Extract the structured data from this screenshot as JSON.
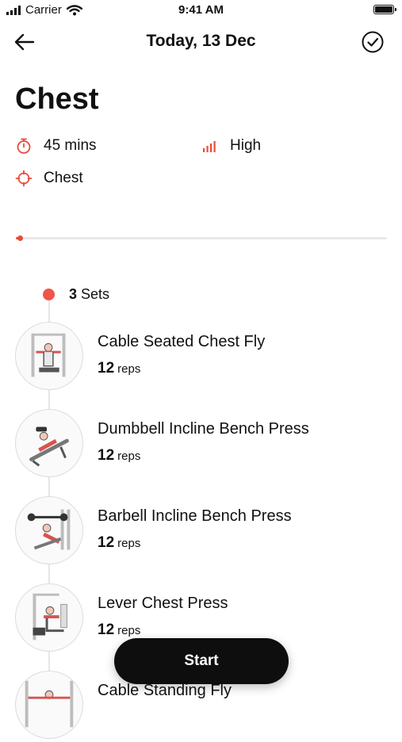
{
  "status_bar": {
    "carrier": "Carrier",
    "time": "9:41 AM"
  },
  "nav": {
    "title": "Today, 13 Dec",
    "back_icon": "arrow-left-icon",
    "confirm_icon": "check-circle-icon"
  },
  "workout": {
    "title": "Chest",
    "duration": "45 mins",
    "intensity": "High",
    "target": "Chest",
    "progress_fraction": 0.01
  },
  "sets": {
    "count": "3",
    "label": "Sets"
  },
  "exercises": [
    {
      "name": "Cable Seated Chest Fly",
      "reps": "12",
      "unit": "reps"
    },
    {
      "name": "Dumbbell Incline Bench Press",
      "reps": "12",
      "unit": "reps"
    },
    {
      "name": "Barbell Incline Bench Press",
      "reps": "12",
      "unit": "reps"
    },
    {
      "name": "Lever Chest Press",
      "reps": "12",
      "unit": "reps"
    },
    {
      "name": "Cable Standing Fly",
      "reps": "",
      "unit": ""
    }
  ],
  "start_button": "Start",
  "colors": {
    "accent": "#e74c3c",
    "button": "#0e0e0e"
  }
}
